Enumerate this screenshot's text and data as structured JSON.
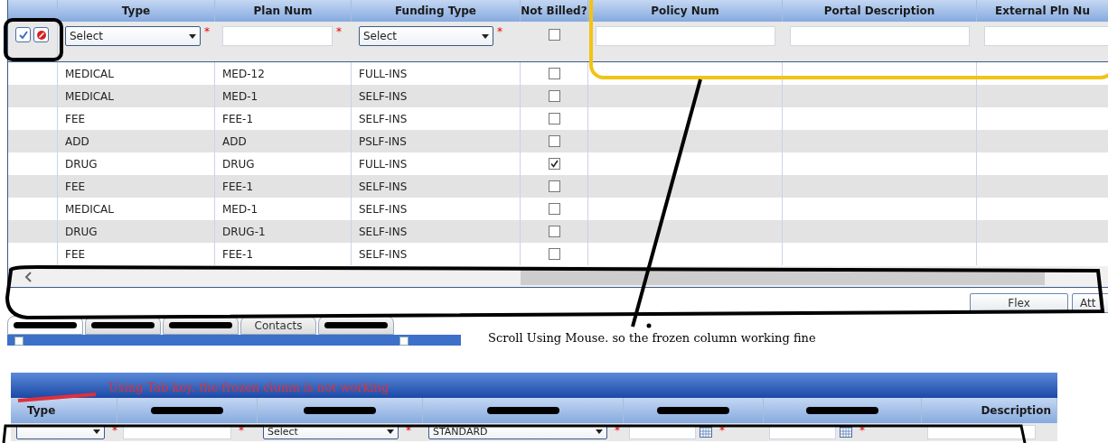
{
  "top_grid": {
    "columns": [
      {
        "label": "Type"
      },
      {
        "label": "Plan Num"
      },
      {
        "label": "Funding Type"
      },
      {
        "label": "Not Billed?"
      },
      {
        "label": "Policy Num"
      },
      {
        "label": "Portal Description"
      },
      {
        "label": "External Pln Nu"
      }
    ],
    "filter_fields": [
      {
        "kind": "actions"
      },
      {
        "kind": "select",
        "value": "Select",
        "required_mark": "*"
      },
      {
        "kind": "text",
        "required_mark": "*"
      },
      {
        "kind": "select",
        "value": "Select",
        "required_mark": "*"
      },
      {
        "kind": "checkbox",
        "checked": false
      },
      {
        "kind": "text"
      },
      {
        "kind": "text"
      },
      {
        "kind": "text"
      }
    ],
    "rows": [
      {
        "type": "MEDICAL",
        "plan_num": "MED-12",
        "funding_type": "FULL-INS",
        "not_billed": false
      },
      {
        "type": "MEDICAL",
        "plan_num": "MED-1",
        "funding_type": "SELF-INS",
        "not_billed": false
      },
      {
        "type": "FEE",
        "plan_num": "FEE-1",
        "funding_type": "SELF-INS",
        "not_billed": false
      },
      {
        "type": "ADD",
        "plan_num": "ADD",
        "funding_type": "PSLF-INS",
        "not_billed": false
      },
      {
        "type": "DRUG",
        "plan_num": "DRUG",
        "funding_type": "FULL-INS",
        "not_billed": true
      },
      {
        "type": "FEE",
        "plan_num": "FEE-1",
        "funding_type": "SELF-INS",
        "not_billed": false
      },
      {
        "type": "MEDICAL",
        "plan_num": "MED-1",
        "funding_type": "SELF-INS",
        "not_billed": false
      },
      {
        "type": "DRUG",
        "plan_num": "DRUG-1",
        "funding_type": "SELF-INS",
        "not_billed": false
      },
      {
        "type": "FEE",
        "plan_num": "FEE-1",
        "funding_type": "SELF-INS",
        "not_billed": false
      }
    ]
  },
  "buttons": [
    "Flex",
    "Att"
  ],
  "tabs": [
    {
      "redacted": true,
      "selected": true
    },
    {
      "redacted": true,
      "selected": false
    },
    {
      "redacted": true,
      "selected": false
    },
    {
      "label": "Contacts",
      "redacted": false,
      "selected": false
    },
    {
      "redacted": true,
      "selected": false
    }
  ],
  "annotations": [
    {
      "text": "Scroll Using Mouse. so the frozen column working fine",
      "color": "#000000"
    },
    {
      "text": "Using Tab key. the frozen clumn is not working",
      "color": "#e0303a"
    }
  ],
  "bottom_grid": {
    "columns": [
      {
        "label": "Type",
        "redacted": false
      },
      {
        "redacted": true
      },
      {
        "redacted": true
      },
      {
        "redacted": true
      },
      {
        "redacted": true
      },
      {
        "redacted": true
      },
      {
        "label": "Description",
        "redacted": false
      }
    ],
    "fields": [
      {
        "kind": "select",
        "required_mark": "*"
      },
      {
        "kind": "text",
        "required_mark": "*"
      },
      {
        "kind": "select",
        "value": "Select",
        "required_mark": "*"
      },
      {
        "kind": "select",
        "value": "STANDARD",
        "required_mark": "*"
      },
      {
        "kind": "date",
        "required_mark": "*"
      },
      {
        "kind": "date",
        "required_mark": "*"
      },
      {
        "kind": "text"
      }
    ]
  }
}
